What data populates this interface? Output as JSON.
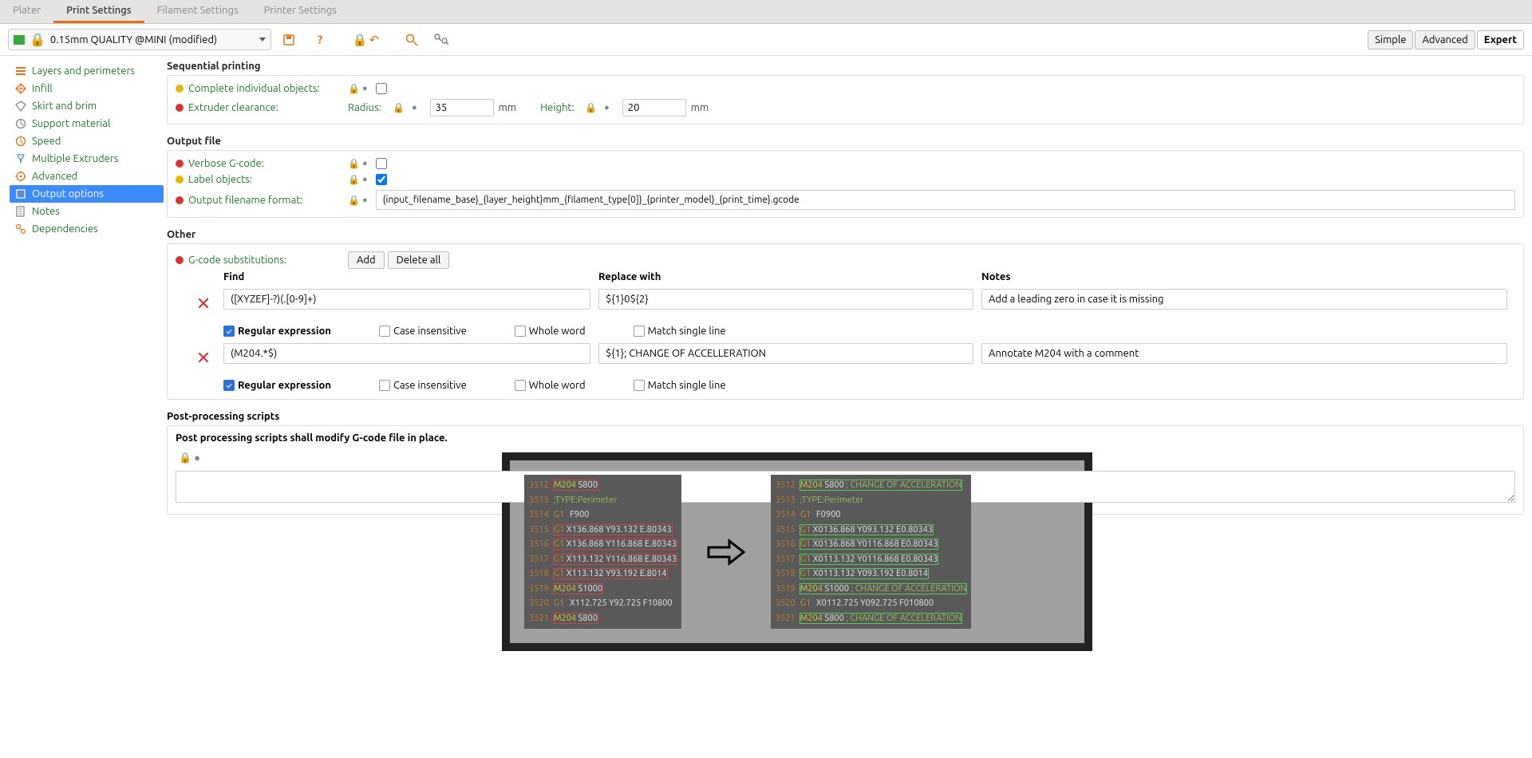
{
  "tabs": [
    "Plater",
    "Print Settings",
    "Filament Settings",
    "Printer Settings"
  ],
  "active_tab": 1,
  "profile_name": "0.15mm QUALITY @MINI (modified)",
  "mode_buttons": [
    "Simple",
    "Advanced",
    "Expert"
  ],
  "mode_active": 2,
  "sidebar": [
    "Layers and perimeters",
    "Infill",
    "Skirt and brim",
    "Support material",
    "Speed",
    "Multiple Extruders",
    "Advanced",
    "Output options",
    "Notes",
    "Dependencies"
  ],
  "sidebar_selected": 7,
  "sequential": {
    "title": "Sequential printing",
    "complete_label": "Complete individual objects:",
    "clearance_label": "Extruder clearance:",
    "radius_label": "Radius:",
    "radius_value": "35",
    "height_label": "Height:",
    "height_value": "20",
    "unit": "mm"
  },
  "output_file": {
    "title": "Output file",
    "verbose_label": "Verbose G-code:",
    "labelobj_label": "Label objects:",
    "labelobj_checked": true,
    "fname_label": "Output filename format:",
    "fname_value": "{input_filename_base}_{layer_height}mm_{filament_type[0]}_{printer_model}_{print_time}.gcode"
  },
  "other": {
    "title": "Other",
    "subs_label": "G-code substitutions:",
    "add_btn": "Add",
    "del_btn": "Delete all",
    "cols": {
      "find": "Find",
      "replace": "Replace with",
      "notes": "Notes"
    },
    "rows": [
      {
        "find": "([XYZEF]-?)(.[0-9]+)",
        "replace": "${1}0${2}",
        "notes": "Add a leading zero in case it is missing",
        "regex": true,
        "ci": false,
        "whole": false,
        "single": false
      },
      {
        "find": "(M204.*$)",
        "replace": "${1}; CHANGE OF ACCELLERATION",
        "notes": "Annotate M204 with a comment",
        "regex": true,
        "ci": false,
        "whole": false,
        "single": false
      }
    ],
    "opt_labels": {
      "regex": "Regular expression",
      "ci": "Case insensitive",
      "whole": "Whole word",
      "single": "Match single line"
    }
  },
  "post": {
    "title": "Post-processing scripts",
    "desc": "Post processing scripts shall modify G-code file in place."
  },
  "example": {
    "before": [
      {
        "ln": "3512",
        "cls": "m204",
        "box": "r",
        "t": "M204 S800"
      },
      {
        "ln": "3513",
        "cls": "cmt",
        "t": ";TYPE:Perimeter"
      },
      {
        "ln": "3514",
        "cls": "g1",
        "t": "G1 F900"
      },
      {
        "ln": "3515",
        "cls": "g1",
        "box": "r",
        "t": "G1 X136.868 Y93.132 E.80343"
      },
      {
        "ln": "3516",
        "cls": "g1",
        "box": "r",
        "t": "G1 X136.868 Y116.868 E.80343"
      },
      {
        "ln": "3517",
        "cls": "g1",
        "box": "r",
        "t": "G1 X113.132 Y116.868 E.80343"
      },
      {
        "ln": "3518",
        "cls": "g1",
        "box": "r",
        "t": "G1 X113.132 Y93.192 E.8014"
      },
      {
        "ln": "3519",
        "cls": "m204",
        "box": "r",
        "t": "M204 S1000"
      },
      {
        "ln": "3520",
        "cls": "g1",
        "t": "G1 X112.725 Y92.725 F10800"
      },
      {
        "ln": "3521",
        "cls": "m204",
        "box": "r",
        "t": "M204 S800"
      }
    ],
    "after": [
      {
        "ln": "3512",
        "cls": "m204",
        "box": "g",
        "t": "M204 S800 ; CHANGE OF ACCELERATION"
      },
      {
        "ln": "3513",
        "cls": "cmt",
        "t": ";TYPE:Perimeter"
      },
      {
        "ln": "3514",
        "cls": "g1",
        "t": "G1 F0900"
      },
      {
        "ln": "3515",
        "cls": "g1",
        "box": "g",
        "t": "G1 X0136.868 Y093.132 E0.80343"
      },
      {
        "ln": "3516",
        "cls": "g1",
        "box": "g",
        "t": "G1 X0136.868 Y0116.868 E0.80343"
      },
      {
        "ln": "3517",
        "cls": "g1",
        "box": "g",
        "t": "G1 X0113.132 Y0116.868 E0.80343"
      },
      {
        "ln": "3518",
        "cls": "g1",
        "box": "g",
        "t": "G1 X0113.132 Y093.192 E0.8014"
      },
      {
        "ln": "3519",
        "cls": "m204",
        "box": "g",
        "t": "M204 S1000 ; CHANGE OF ACCELERATION"
      },
      {
        "ln": "3520",
        "cls": "g1",
        "t": "G1 X0112.725 Y092.725 F010800"
      },
      {
        "ln": "3521",
        "cls": "m204",
        "box": "g",
        "t": "M204 S800 ; CHANGE OF ACCELERATION"
      }
    ]
  }
}
